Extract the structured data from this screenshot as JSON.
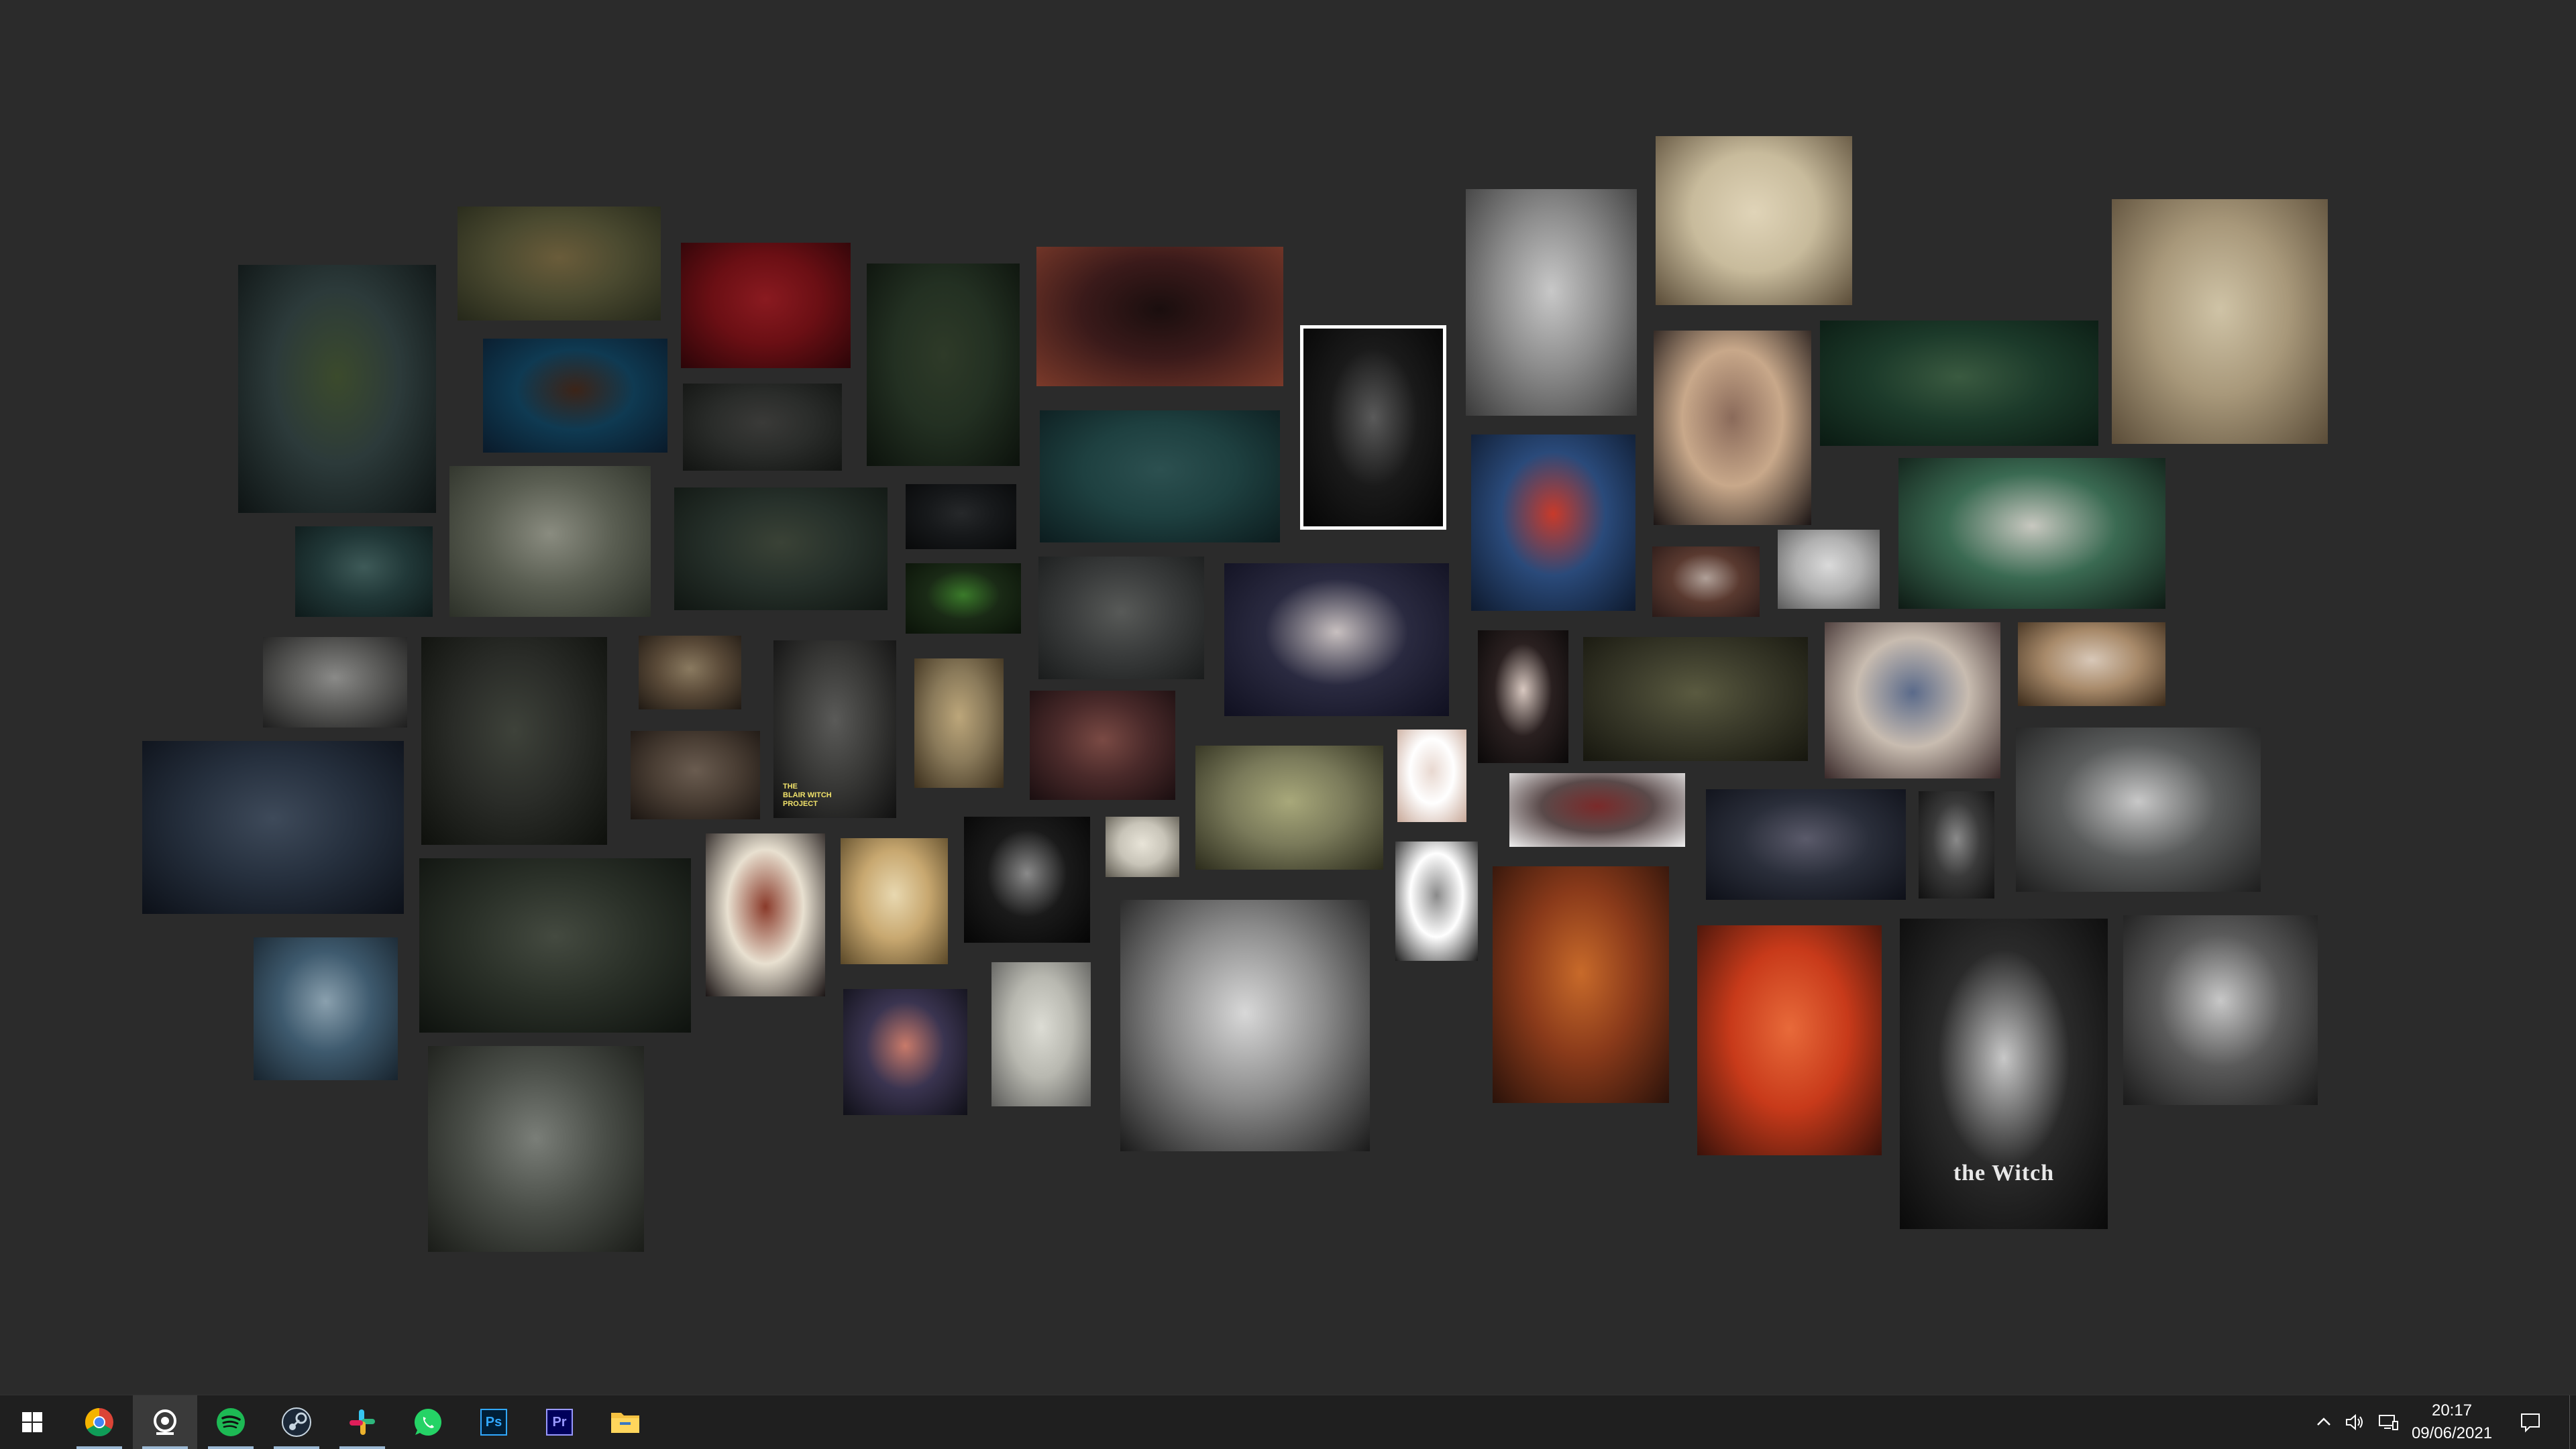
{
  "desktop": {
    "background_color": "#2b2b2b",
    "images": [
      {
        "name": "cabin-in-forest-photo",
        "colors": [
          "#2c3a3a",
          "#0e1414",
          "#3b4a2c"
        ]
      },
      {
        "name": "forest-stump-photo",
        "colors": [
          "#4b4a30",
          "#25281a",
          "#6a5c3a"
        ]
      },
      {
        "name": "red-forest-photo",
        "colors": [
          "#6b0f14",
          "#2b0508",
          "#8a1a20"
        ]
      },
      {
        "name": "dark-forest-photo",
        "colors": [
          "#233022",
          "#0c120c",
          "#2e3a28"
        ]
      },
      {
        "name": "red-demon-figure-art",
        "colors": [
          "#3a1a1a",
          "#7b3a2a",
          "#1a0e0e"
        ]
      },
      {
        "name": "blue-forest-photo",
        "colors": [
          "#0f3a52",
          "#0a1a2a",
          "#3c2418"
        ]
      },
      {
        "name": "dark-woods-photo",
        "colors": [
          "#2a2c2a",
          "#121412",
          "#3a3a38"
        ]
      },
      {
        "name": "teal-forest-photo",
        "colors": [
          "#1e4040",
          "#0c1c1e",
          "#2c5050"
        ]
      },
      {
        "name": "misty-forest-photo",
        "colors": [
          "#5a5e52",
          "#2c3028",
          "#8a8c80"
        ]
      },
      {
        "name": "forest-path-figure-photo",
        "colors": [
          "#26302a",
          "#101612",
          "#3a4236"
        ]
      },
      {
        "name": "dark-trees-photo",
        "colors": [
          "#16181a",
          "#08090a",
          "#26282a"
        ]
      },
      {
        "name": "green-glow-forest-photo",
        "colors": [
          "#1a2a16",
          "#0a1208",
          "#3a7a2a"
        ]
      },
      {
        "name": "misty-teal-woods-photo",
        "colors": [
          "#213838",
          "#0e1a1a",
          "#3e5a58"
        ]
      },
      {
        "name": "bare-forest-figures-photo",
        "colors": [
          "#3a3c3c",
          "#1a1c1c",
          "#585a58"
        ]
      },
      {
        "name": "tall-creature-drawing",
        "colors": [
          "#1a1a1a",
          "#050505",
          "#5a5a5a"
        ]
      },
      {
        "name": "gnarled-tree-engraving",
        "colors": [
          "#8c8c8c",
          "#3a3a3a",
          "#c8c8c8"
        ]
      },
      {
        "name": "devil-woodcut-engraving",
        "colors": [
          "#c8bb9c",
          "#5a4c38",
          "#e0d4b8"
        ]
      },
      {
        "name": "rabbit-mask-photo",
        "colors": [
          "#c8a88a",
          "#1a1414",
          "#8a6a5a"
        ]
      },
      {
        "name": "green-creature-photo",
        "colors": [
          "#1c3a2a",
          "#0a1a12",
          "#3a5a40"
        ]
      },
      {
        "name": "wicker-man-engraving",
        "colors": [
          "#a8987a",
          "#5a4c38",
          "#cfc3a6"
        ]
      },
      {
        "name": "folk-witch-painting",
        "colors": [
          "#2a4a7a",
          "#0e1a2e",
          "#c83a2a"
        ]
      },
      {
        "name": "animal-masks-people-photo",
        "colors": [
          "#2a3050",
          "#101428",
          "#b8b0b0"
        ]
      },
      {
        "name": "masked-figure-photo",
        "colors": [
          "#5a3a30",
          "#2a1a18",
          "#b0a098"
        ]
      },
      {
        "name": "old-face-photo",
        "colors": [
          "#b0b0b0",
          "#5a5a5a",
          "#dadada"
        ]
      },
      {
        "name": "green-deer-skulls-art",
        "colors": [
          "#3a6a52",
          "#0e1a14",
          "#c8c8c0"
        ]
      },
      {
        "name": "foggy-field-photo",
        "colors": [
          "#5a5a58",
          "#1e1e1e",
          "#8a8a88"
        ]
      },
      {
        "name": "creepy-tree-art",
        "colors": [
          "#2a2c28",
          "#0e100c",
          "#3e423a"
        ]
      },
      {
        "name": "tree-stump-close-photo",
        "colors": [
          "#5a4a38",
          "#201a14",
          "#8a7a60"
        ]
      },
      {
        "name": "blair-witch-project-poster",
        "colors": [
          "#3a3a38",
          "#101010",
          "#5a5a58"
        ],
        "title_lines": [
          "THE",
          "BLAIR WITCH",
          "PROJECT"
        ]
      },
      {
        "name": "horned-witch-figure-art",
        "colors": [
          "#8a7a5a",
          "#3a2e1c",
          "#bca67a"
        ]
      },
      {
        "name": "autumn-path-photo",
        "colors": [
          "#4a2a2a",
          "#1a0e10",
          "#7a4a44"
        ]
      },
      {
        "name": "animal-masked-people-photo",
        "colors": [
          "#2a2a40",
          "#101020",
          "#c8c0c0"
        ]
      },
      {
        "name": "white-face-mask-photo",
        "colors": [
          "#2a2020",
          "#0a0808",
          "#d8c8c0"
        ]
      },
      {
        "name": "overgrown-hut-photo",
        "colors": [
          "#3a3a2a",
          "#16160e",
          "#5a5a40"
        ]
      },
      {
        "name": "demon-figures-manuscript",
        "colors": [
          "#c8bcb0",
          "#3a2a2a",
          "#5a6a8a"
        ]
      },
      {
        "name": "bear-masks-children-photo",
        "colors": [
          "#a88a6a",
          "#3a2a1a",
          "#d8c8b8"
        ]
      },
      {
        "name": "misty-lake-figure-photo",
        "colors": [
          "#26303e",
          "#0c1018",
          "#3e4a5a"
        ]
      },
      {
        "name": "old-cabin-woods-photo",
        "colors": [
          "#4a3e34",
          "#1c1612",
          "#6a5c50"
        ]
      },
      {
        "name": "ritual-circle-pond-art",
        "colors": [
          "#7a7a5a",
          "#2c2c1c",
          "#a8a87a"
        ]
      },
      {
        "name": "pale-mask-photo",
        "colors": [
          "#ffffff",
          "#c8a898",
          "#e8d8d0"
        ]
      },
      {
        "name": "masked-group-photo",
        "colors": [
          "#5a4a4a",
          "#f0f0f0",
          "#7a2a2a"
        ]
      },
      {
        "name": "straw-creatures-photo",
        "colors": [
          "#2a2e3a",
          "#0e1018",
          "#5a5a6a"
        ]
      },
      {
        "name": "black-furred-creature-photo",
        "colors": [
          "#3a3a3a",
          "#101010",
          "#8a8a8a"
        ]
      },
      {
        "name": "horned-goat-creature-photo",
        "colors": [
          "#5a5c5c",
          "#1e1e1e",
          "#c8c8c8"
        ]
      },
      {
        "name": "cloudy-forest-hills-photo",
        "colors": [
          "#3e5a6e",
          "#18242e",
          "#8aa0ae"
        ]
      },
      {
        "name": "swamp-creature-art",
        "colors": [
          "#2a3028",
          "#0e120e",
          "#444a40"
        ]
      },
      {
        "name": "white-serpent-deer-art",
        "colors": [
          "#e8e0d0",
          "#1a1414",
          "#8a3a2a"
        ]
      },
      {
        "name": "golden-deity-art",
        "colors": [
          "#c8a870",
          "#5a4828",
          "#e8d8b0"
        ]
      },
      {
        "name": "occult-symbols-art",
        "colors": [
          "#1a1a1a",
          "#050505",
          "#8a8a8a"
        ]
      },
      {
        "name": "vintage-witches-engraving",
        "colors": [
          "#c8c4b8",
          "#5a564c",
          "#e8e4d8"
        ]
      },
      {
        "name": "black-horse-sunset-art",
        "colors": [
          "#3a3450",
          "#101018",
          "#c87a6a"
        ]
      },
      {
        "name": "dancing-witch-etching",
        "colors": [
          "#b8b8b0",
          "#5a5a58",
          "#dcdcd4"
        ]
      },
      {
        "name": "dark-tree-figure-drawing",
        "colors": [
          "#8a8a8a",
          "#1a1a1a",
          "#d8d8d8"
        ]
      },
      {
        "name": "woodcut-ritual-print",
        "colors": [
          "#ffffff",
          "#1a1a1a",
          "#8a8a8a"
        ]
      },
      {
        "name": "red-hooded-witches-art",
        "colors": [
          "#8a3a1a",
          "#2a120a",
          "#c86a2a"
        ]
      },
      {
        "name": "red-demon-painting",
        "colors": [
          "#c83a1a",
          "#3a120a",
          "#e86a3a"
        ]
      },
      {
        "name": "the-witch-poster",
        "colors": [
          "#2a2a2a",
          "#0a0a0a",
          "#c8c8c8"
        ],
        "title": "the Witch"
      },
      {
        "name": "moonlit-dancers-art",
        "colors": [
          "#5a5a5a",
          "#1a1a1a",
          "#c8c8c8"
        ]
      },
      {
        "name": "old-witch-crow-painting",
        "colors": [
          "#5a6a4a",
          "#1e2418",
          "#c8b888"
        ]
      },
      {
        "name": "abandoned-shed-photo",
        "colors": [
          "#4a4e48",
          "#1a1c18",
          "#7a7e78"
        ]
      }
    ]
  },
  "taskbar": {
    "buttons": [
      {
        "name": "start-button",
        "icon": "windows-icon"
      },
      {
        "name": "chrome-button",
        "icon": "chrome-icon"
      },
      {
        "name": "webcam-app-button",
        "icon": "webcam-icon"
      },
      {
        "name": "spotify-button",
        "icon": "spotify-icon"
      },
      {
        "name": "steam-button",
        "icon": "steam-icon"
      },
      {
        "name": "slack-button",
        "icon": "slack-icon"
      },
      {
        "name": "whatsapp-button",
        "icon": "whatsapp-icon"
      },
      {
        "name": "photoshop-button",
        "icon": "photoshop-icon",
        "label": "Ps"
      },
      {
        "name": "premiere-button",
        "icon": "premiere-icon",
        "label": "Pr"
      },
      {
        "name": "file-explorer-button",
        "icon": "folder-icon"
      }
    ],
    "tray": {
      "icons": [
        "chevron-up-icon",
        "volume-icon",
        "network-icon"
      ],
      "time": "20:17",
      "date": "09/06/2021",
      "notification_icon": "notification-icon"
    }
  },
  "colors": {
    "taskbar_bg": "#1f1f1f",
    "active_underline": "#9bb8d3",
    "spotify_green": "#1db954",
    "ps_blue": "#31a8ff",
    "pr_purple": "#9999ff",
    "whatsapp_green": "#25d366",
    "folder_yellow": "#f5c242"
  }
}
